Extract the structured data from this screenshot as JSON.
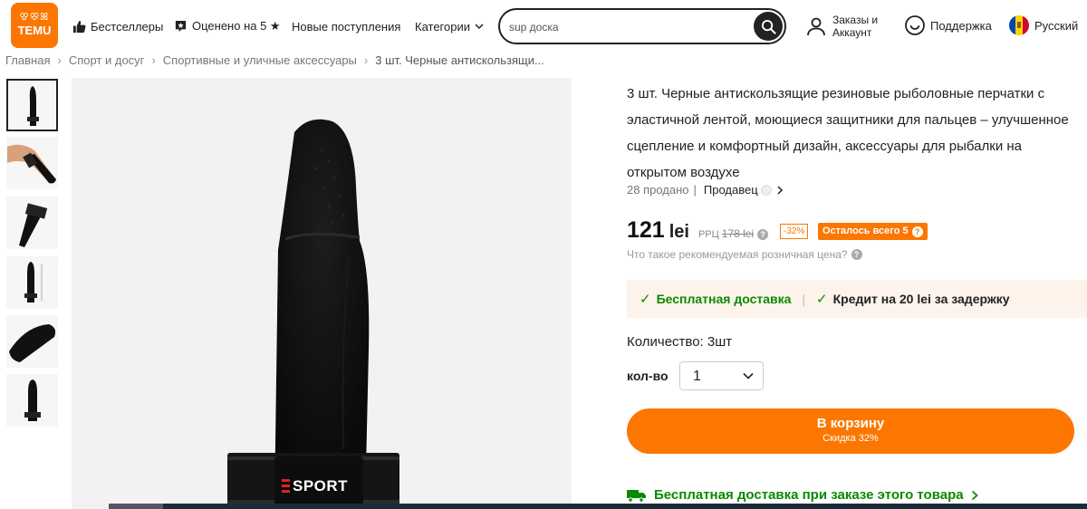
{
  "header": {
    "logo_glyphs": "ꕢꕣꕤ",
    "logo_text": "TEMU",
    "nav": [
      {
        "label": "Бестселлеры",
        "icon": "thumbs-up-icon"
      },
      {
        "label": "Оценено на 5 ★",
        "icon": "star-badge-icon"
      },
      {
        "label": "Новые поступления",
        "icon": ""
      },
      {
        "label": "Категории",
        "icon": "chevron-down-icon"
      }
    ],
    "search_value": "sup доска",
    "account_line1": "Заказы и",
    "account_line2": "Аккаунт",
    "support": "Поддержка",
    "language": "Русский"
  },
  "breadcrumb": [
    "Главная",
    "Спорт и досуг",
    "Спортивные и уличные аксессуары",
    "3 шт. Черные антискользящи..."
  ],
  "product": {
    "title": "3 шт. Черные антискользящие резиновые рыболовные перчатки с эластичной лентой, моющиеся защитники для пальцев – улучшенное сцепление и комфортный дизайн, аксессуары для рыбалки на открытом воздухе",
    "sold": "28 продано",
    "seller_sep": "|",
    "seller_label": "Продавец",
    "price": "121",
    "currency": "lei",
    "rrp_label": "РРЦ",
    "rrp_value": "178 lei",
    "discount": "-32%",
    "stock": "Осталось всего 5",
    "rrp_question": "Что такое рекомендуемая розничная цена?",
    "delivery_free": "Бесплатная доставка",
    "delivery_divider": "|",
    "delivery_credit": "Кредит на 20 lei за задержку",
    "quantity_label": "Количество: 3шт",
    "qty_short": "кол-во",
    "qty_value": "1",
    "cart_label": "В корзину",
    "cart_sub": "Скидка 32%",
    "free_ship_order": "Бесплатная доставка при заказе этого товара",
    "image_brand": "SPORT"
  },
  "thumbnails": 6,
  "colors": {
    "accent": "#fb7701",
    "green": "#0a8a00",
    "delivery_bg": "#fdf3ea"
  }
}
